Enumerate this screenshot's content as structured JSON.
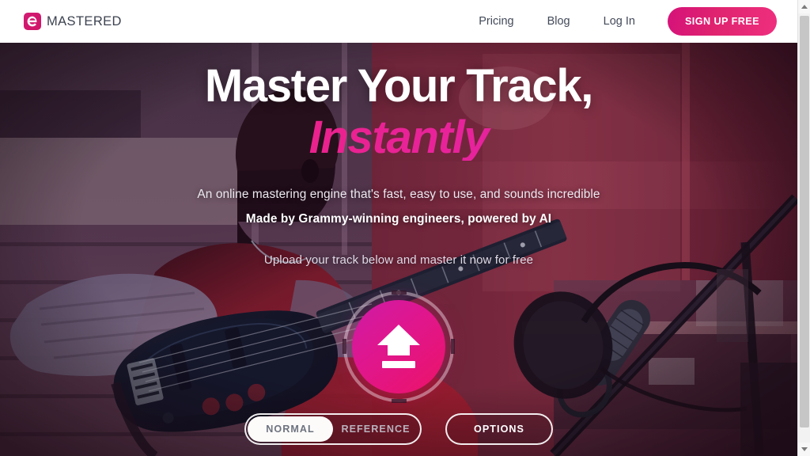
{
  "header": {
    "brand_mark_icon": "emastered-e-logo-icon",
    "brand_name": "MASTERED",
    "nav": [
      {
        "label": "Pricing",
        "name": "pricing"
      },
      {
        "label": "Blog",
        "name": "blog"
      },
      {
        "label": "Log In",
        "name": "login"
      }
    ],
    "signup_label": "SIGN UP FREE"
  },
  "hero": {
    "headline_line1": "Master Your Track,",
    "headline_line2": "Instantly",
    "subtitle_1": "An online mastering engine that's fast, easy to use, and sounds incredible",
    "subtitle_2": "Made by Grammy-winning engineers, powered by AI",
    "subtitle_3": "Upload your track below and master it now for free",
    "upload_icon": "upload-arrow-icon"
  },
  "controls": {
    "mode_normal": "NORMAL",
    "mode_reference": "REFERENCE",
    "mode_selected": "NORMAL",
    "options_label": "OPTIONS"
  },
  "scrollbar": {
    "up_icon": "scroll-up-arrow-icon",
    "down_icon": "scroll-down-arrow-icon"
  },
  "colors": {
    "brand_pink": "#d5127a",
    "accent_magenta": "#e8239a",
    "accent_hot_pink": "#ef1f6e",
    "nav_text": "#434a59",
    "header_bg": "#ffffff"
  }
}
